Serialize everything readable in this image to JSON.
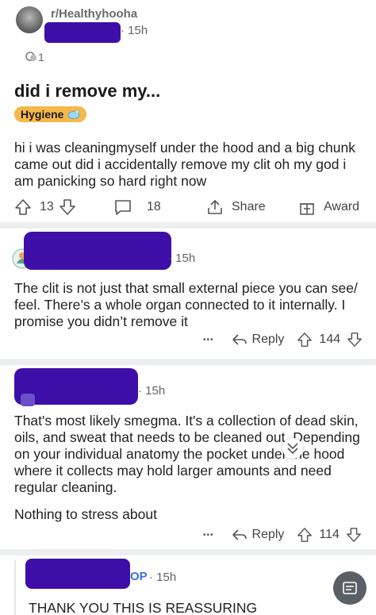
{
  "post": {
    "subreddit": "r/Healthyhooha",
    "time": "15h",
    "flair_count": "1",
    "title": "did i remove my...",
    "tag": "Hygiene",
    "body": "hi i was cleaningmyself under the hood and a big chunk came out did i accidentally remove my clit oh my god i am panicking so hard right now",
    "upvotes": "13",
    "comments": "18",
    "share_label": "Share",
    "award_label": "Award"
  },
  "comments": [
    {
      "time": "15h",
      "text": "The clit is not just that small external piece you can see/ feel. There’s a whole organ connected to it internally. I promise you didn’t remove it",
      "more": "•••",
      "reply_label": "Reply",
      "votes": "144"
    },
    {
      "time": "15h",
      "text1": "That's most likely smegma. It's a collection of dead skin, oils, and sweat that needs to be cleaned out. Depending on your individual anatomy the pocket under the hood where it collects may hold larger amounts and need regular cleaning.",
      "text2": "Nothing to stress about",
      "more": "•••",
      "reply_label": "Reply",
      "votes": "114"
    },
    {
      "op_badge": "OP",
      "time": "15h",
      "text": "THANK YOU THIS IS REASSURING"
    }
  ],
  "colors": {
    "accent": "#3d0fa8",
    "tag_bg": "#f5b84a"
  },
  "icons": [
    "upvote-icon",
    "downvote-icon",
    "comment-icon",
    "share-icon",
    "award-icon",
    "reply-icon",
    "chevron-down-icon",
    "translate-icon"
  ]
}
